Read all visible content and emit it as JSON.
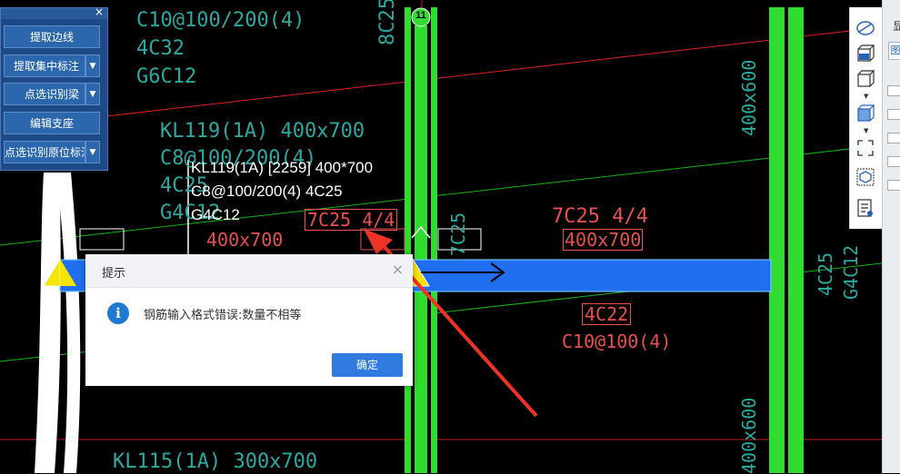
{
  "axis": {
    "label": "11"
  },
  "left_panel": {
    "buttons": [
      {
        "label": "提取边线",
        "dropdown": false
      },
      {
        "label": "提取集中标注",
        "dropdown": true
      },
      {
        "label": "点选识别梁",
        "dropdown": true
      },
      {
        "label": "编辑支座",
        "dropdown": false
      },
      {
        "label": "点选识别原位标注",
        "dropdown": true
      }
    ]
  },
  "cad": {
    "top_left_lines": [
      "C10@100/200(4)",
      "4C32",
      "G6C12"
    ],
    "top_vertical": "8C25",
    "kl119_lines": [
      "KL119(1A) 400x700",
      "C8@100/200(4)",
      "4C25",
      "G4C12"
    ],
    "tooltip_lines": [
      "KL119(1A) [2259] 400*700",
      "C8@100/200(4) 4C25",
      "G4C12"
    ],
    "rebar_box_left": "7C25 4/4",
    "dim_left": "400x700",
    "col_label": "7C25",
    "rebar_mid": "7C25 4/4",
    "dim_mid": "400x700",
    "boxed_4c22": "4C22",
    "stirrup_mid": "C10@100(4)",
    "dim_right_top": "400x600",
    "right_vertical_1": "4C25",
    "right_vertical_2": "G4C12",
    "dim_right_bottom": "400x600",
    "kl115_label": "KL115(1A) 300x700"
  },
  "dialog": {
    "title": "提示",
    "close": "×",
    "info_glyph": "i",
    "message": "钢筋输入格式错误:数量不相等",
    "ok": "确定"
  },
  "right_panel": {
    "tab_label": "显",
    "tab_label2": "图"
  },
  "colors": {
    "column_green": "#2fdc2f",
    "beam_blue": "#1f6ff0",
    "cad_teal": "#2aa9a0",
    "cad_red": "#e85050",
    "arrow_red": "#ee3326"
  }
}
